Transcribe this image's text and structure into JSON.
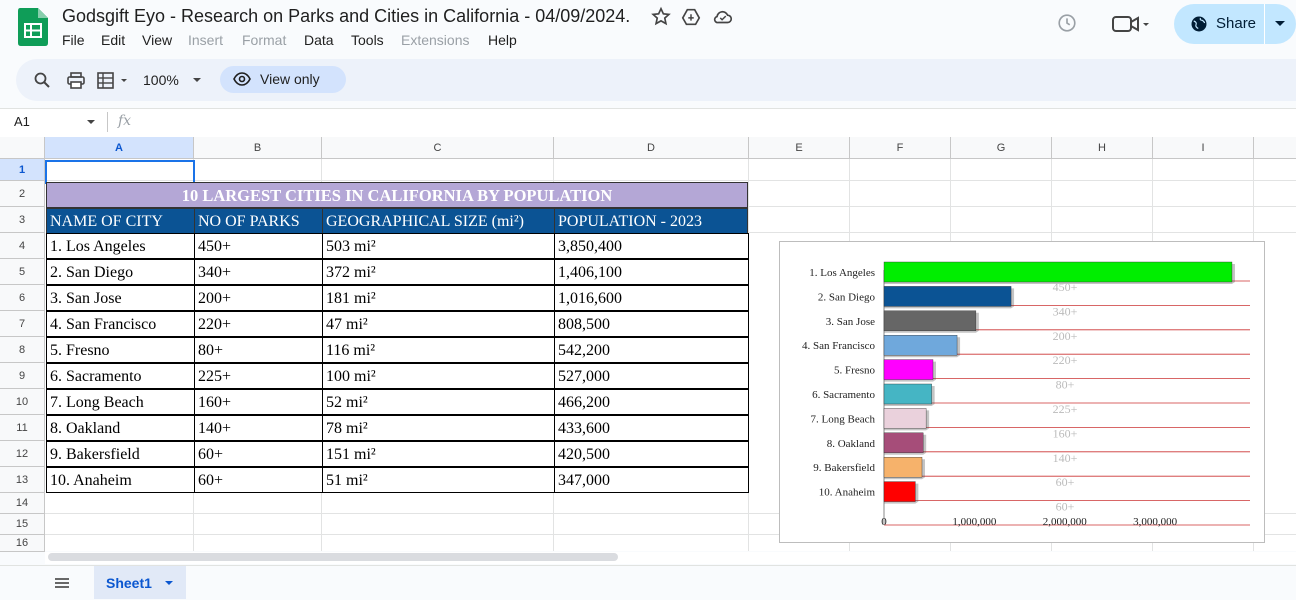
{
  "app": {
    "title": "Godsgift Eyo - Research on Parks and Cities in California - 04/09/2024.",
    "menu": [
      "File",
      "Edit",
      "View",
      "Insert",
      "Format",
      "Data",
      "Tools",
      "Extensions",
      "Help"
    ],
    "menu_disabled": [
      "Insert",
      "Format",
      "Extensions"
    ],
    "share_label": "Share",
    "brand_color": "#0f9d58"
  },
  "toolbar": {
    "zoom": "100%",
    "view_only_label": "View only"
  },
  "formula_bar": {
    "cell_ref": "A1",
    "fx": "fx"
  },
  "grid": {
    "columns": [
      "A",
      "B",
      "C",
      "D",
      "E",
      "F",
      "G",
      "H",
      "I"
    ],
    "rows": [
      "1",
      "2",
      "3",
      "4",
      "5",
      "6",
      "7",
      "8",
      "9",
      "10",
      "11",
      "12",
      "13",
      "14",
      "15",
      "16"
    ],
    "selected_cell": "A1"
  },
  "table": {
    "title": "10 LARGEST CITIES IN CALIFORNIA BY POPULATION",
    "headers": [
      "NAME OF CITY",
      "NO OF PARKS",
      "GEOGRAPHICAL SIZE (mi²)",
      "POPULATION - 2023"
    ],
    "rows": [
      [
        "1. Los Angeles",
        "450+",
        "503 mi²",
        "3,850,400"
      ],
      [
        "2. San Diego",
        "340+",
        "372 mi²",
        "1,406,100"
      ],
      [
        "3. San Jose",
        "200+",
        "181 mi²",
        "1,016,600"
      ],
      [
        "4. San Francisco",
        "220+",
        "47 mi²",
        "808,500"
      ],
      [
        "5. Fresno",
        "80+",
        "116 mi²",
        "542,200"
      ],
      [
        "6. Sacramento",
        "225+",
        "100 mi²",
        "527,000"
      ],
      [
        "7. Long Beach",
        "160+",
        "52 mi²",
        "466,200"
      ],
      [
        "8. Oakland",
        "140+",
        "78 mi²",
        "433,600"
      ],
      [
        "9. Bakersfield",
        "60+",
        "151 mi²",
        "420,500"
      ],
      [
        "10. Anaheim",
        "60+",
        "51 mi²",
        "347,000"
      ]
    ],
    "title_color": "#b4a7d6",
    "header_color": "#0b5394"
  },
  "chart_data": {
    "type": "bar",
    "orientation": "horizontal",
    "categories": [
      "1. Los Angeles",
      "2. San Diego",
      "3. San Jose",
      "4. San Francisco",
      "5. Fresno",
      "6. Sacramento",
      "7. Long Beach",
      "8. Oakland",
      "9. Bakersfield",
      "10. Anaheim"
    ],
    "values": [
      3850400,
      1406100,
      1016600,
      808500,
      542200,
      527000,
      466200,
      433600,
      420500,
      347000
    ],
    "data_labels": [
      "450+",
      "340+",
      "200+",
      "220+",
      "80+",
      "225+",
      "160+",
      "140+",
      "60+",
      "60+"
    ],
    "colors": [
      "#00ee00",
      "#0b5394",
      "#666666",
      "#6fa8dc",
      "#ff00ff",
      "#45b5c4",
      "#ead1dc",
      "#a64d79",
      "#f6b26b",
      "#ff0000"
    ],
    "xlim": [
      0,
      3850400
    ],
    "x_ticks": [
      "0",
      "1,000,000",
      "2,000,000",
      "3,000,000"
    ],
    "x_tick_values": [
      0,
      1000000,
      2000000,
      3000000
    ],
    "grid": true,
    "title": "",
    "xlabel": "",
    "ylabel": ""
  },
  "sheets": [
    "Sheet1"
  ]
}
